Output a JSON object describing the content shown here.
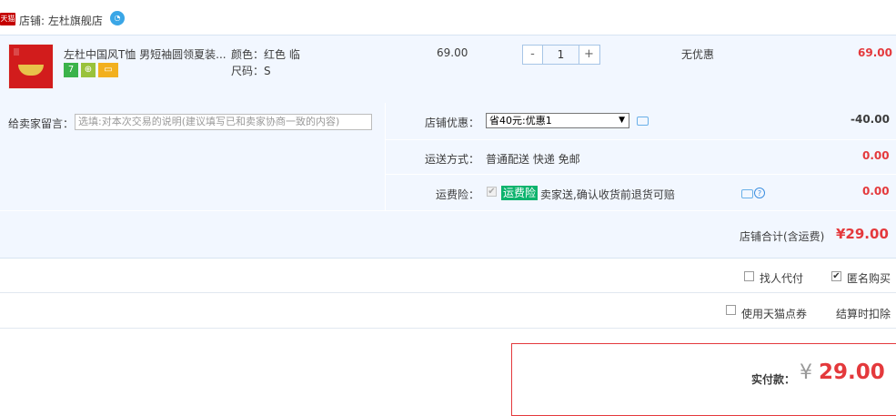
{
  "shop": {
    "logo_text": "天猫",
    "label": "店铺: 左杜旗舰店",
    "wangwang_icon": "chat-bubble-icon"
  },
  "item": {
    "title": "左杜中国风T恤 男短袖圆领夏装...",
    "color_label": "颜色：红色 临",
    "size_label": "尺码：S",
    "badges": [
      "7",
      "⊕",
      "▭"
    ],
    "price": "69.00",
    "quantity": "1",
    "qty_minus": "-",
    "qty_plus": "+",
    "discount": "无优惠",
    "subtotal": "69.00"
  },
  "message": {
    "label": "给卖家留言：",
    "placeholder": "选填:对本次交易的说明(建议填写已和卖家协商一致的内容)"
  },
  "shop_discount": {
    "label": "店铺优惠：",
    "selected": "省40元:优惠1",
    "amount": "-40.00"
  },
  "shipping": {
    "label": "运送方式：",
    "value": "普通配送 快递 免邮",
    "amount": "0.00"
  },
  "freight_insurance": {
    "label": "运费险：",
    "tag": "运费险",
    "desc": "卖家送,确认收货前退货可赔",
    "amount": "0.00"
  },
  "shop_total": {
    "label": "店铺合计(含运费)",
    "amount": "¥29.00"
  },
  "options": {
    "pay_for_me": "找人代付",
    "anonymous": "匿名购买",
    "use_coupon": "使用天猫点券",
    "deduct_note": "结算时扣除"
  },
  "final": {
    "label": "实付款：",
    "currency": "¥",
    "amount": "29.00"
  },
  "colors": {
    "accent_red": "#e4393c",
    "row_bg": "#f2f7ff",
    "insurance_green": "#0cb36d"
  }
}
